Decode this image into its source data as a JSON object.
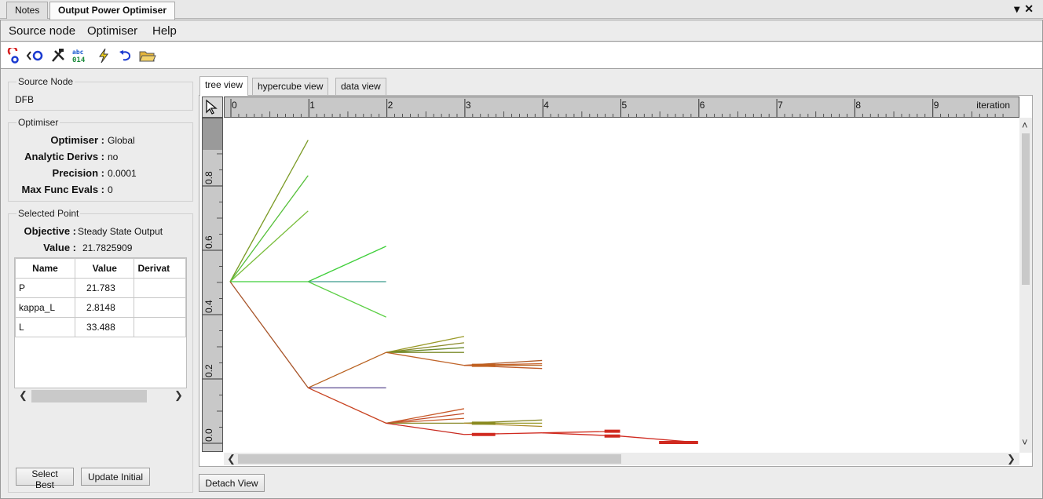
{
  "doc_tabs": [
    {
      "label": "Notes"
    },
    {
      "label": "Output Power Optimiser"
    }
  ],
  "menu": [
    "Source node",
    "Optimiser",
    "Help"
  ],
  "toolbar_icons": [
    "run-icon",
    "step-icon",
    "tools-icon",
    "binary-icon",
    "lightning-icon",
    "undo-icon",
    "open-folder-icon"
  ],
  "source_node": {
    "title": "Source Node",
    "value": "DFB"
  },
  "optimiser": {
    "title": "Optimiser",
    "rows": [
      {
        "label": "Optimiser :",
        "value": "Global"
      },
      {
        "label": "Analytic Derivs :",
        "value": "no"
      },
      {
        "label": "Precision :",
        "value": "0.0001"
      },
      {
        "label": "Max Func Evals :",
        "value": "0"
      }
    ]
  },
  "selected_point": {
    "title": "Selected Point",
    "objective_label": "Objective :",
    "objective_value": "Steady State Output",
    "value_label": "Value :",
    "value_value": "21.7825909",
    "columns": [
      "Name",
      "Value",
      "Derivat"
    ],
    "rows": [
      {
        "name": "P",
        "value": "21.783",
        "deriv": ""
      },
      {
        "name": "kappa_L",
        "value": "2.8148",
        "deriv": ""
      },
      {
        "name": "L",
        "value": "33.488",
        "deriv": ""
      }
    ]
  },
  "buttons": {
    "select_best": "Select Best",
    "update_initial": "Update Initial",
    "detach_view": "Detach View"
  },
  "view_tabs": [
    "tree view",
    "hypercube view",
    "data view"
  ],
  "ruler": {
    "ticks": [
      "0",
      "1",
      "2",
      "3",
      "4",
      "5",
      "6",
      "7",
      "8",
      "9"
    ],
    "label": "iteration"
  },
  "y_ruler": {
    "ticks": [
      "0.0",
      "0.2",
      "0.4",
      "0.6",
      "0.8"
    ]
  },
  "chart_data": {
    "type": "line",
    "title": "",
    "xlabel": "iteration",
    "ylabel": "",
    "xlim": [
      0,
      9.1
    ],
    "ylim": [
      0,
      1.0
    ],
    "series": [
      {
        "color": "#7a9a24",
        "points": [
          [
            0,
            0.5
          ],
          [
            1,
            0.94
          ]
        ]
      },
      {
        "color": "#55c03a",
        "points": [
          [
            0,
            0.5
          ],
          [
            1,
            0.83
          ]
        ]
      },
      {
        "color": "#78bd3a",
        "points": [
          [
            0,
            0.5
          ],
          [
            1,
            0.72
          ]
        ]
      },
      {
        "color": "#3fcf3a",
        "points": [
          [
            0,
            0.5
          ],
          [
            1,
            0.5
          ]
        ]
      },
      {
        "color": "#3fcf3a",
        "points": [
          [
            1,
            0.5
          ],
          [
            2,
            0.61
          ]
        ]
      },
      {
        "color": "#3a9a8c",
        "points": [
          [
            1,
            0.5
          ],
          [
            2,
            0.5
          ]
        ]
      },
      {
        "color": "#5ccf45",
        "points": [
          [
            1,
            0.5
          ],
          [
            2,
            0.39
          ]
        ]
      },
      {
        "color": "#a8552a",
        "points": [
          [
            0,
            0.5
          ],
          [
            1,
            0.17
          ]
        ]
      },
      {
        "color": "#6a5a9a",
        "points": [
          [
            1,
            0.17
          ],
          [
            2,
            0.17
          ]
        ]
      },
      {
        "color": "#b8601e",
        "points": [
          [
            1,
            0.17
          ],
          [
            2,
            0.28
          ]
        ]
      },
      {
        "color": "#c84220",
        "points": [
          [
            1,
            0.17
          ],
          [
            2,
            0.06
          ]
        ]
      },
      {
        "color": "#9a9a28",
        "points": [
          [
            2,
            0.28
          ],
          [
            3,
            0.33
          ]
        ]
      },
      {
        "color": "#8a8a2a",
        "points": [
          [
            2,
            0.28
          ],
          [
            3,
            0.31
          ]
        ]
      },
      {
        "color": "#6a8a2a",
        "points": [
          [
            2,
            0.28
          ],
          [
            3,
            0.295
          ]
        ]
      },
      {
        "color": "#7a8a28",
        "points": [
          [
            2,
            0.28
          ],
          [
            3,
            0.28
          ]
        ]
      },
      {
        "color": "#c0652a",
        "points": [
          [
            2,
            0.28
          ],
          [
            3,
            0.24
          ]
        ]
      },
      {
        "color": "#b05a28",
        "points": [
          [
            3,
            0.24
          ],
          [
            4,
            0.255
          ]
        ]
      },
      {
        "color": "#c8622a",
        "points": [
          [
            3,
            0.24
          ],
          [
            4,
            0.245
          ]
        ]
      },
      {
        "color": "#b86a2a",
        "points": [
          [
            3,
            0.24
          ],
          [
            4,
            0.24
          ]
        ]
      },
      {
        "color": "#c05a28",
        "points": [
          [
            3,
            0.24
          ],
          [
            4,
            0.23
          ]
        ]
      },
      {
        "color": "#c85a2a",
        "points": [
          [
            2,
            0.06
          ],
          [
            3,
            0.105
          ]
        ]
      },
      {
        "color": "#c04a28",
        "points": [
          [
            2,
            0.06
          ],
          [
            3,
            0.09
          ]
        ]
      },
      {
        "color": "#c85a2a",
        "points": [
          [
            2,
            0.06
          ],
          [
            3,
            0.075
          ]
        ]
      },
      {
        "color": "#8a8a2a",
        "points": [
          [
            2,
            0.06
          ],
          [
            3,
            0.06
          ]
        ]
      },
      {
        "color": "#c82a20",
        "points": [
          [
            2,
            0.06
          ],
          [
            3,
            0.025
          ]
        ]
      },
      {
        "color": "#8a8a2a",
        "points": [
          [
            3,
            0.06
          ],
          [
            4,
            0.07
          ]
        ]
      },
      {
        "color": "#9a9a28",
        "points": [
          [
            3,
            0.06
          ],
          [
            4,
            0.06
          ]
        ]
      },
      {
        "color": "#aa8a28",
        "points": [
          [
            3,
            0.06
          ],
          [
            4,
            0.05
          ]
        ]
      },
      {
        "color": "#d02a20",
        "points": [
          [
            3,
            0.025
          ],
          [
            4,
            0.03
          ]
        ]
      },
      {
        "color": "#d03020",
        "points": [
          [
            4,
            0.03
          ],
          [
            5,
            0.035
          ]
        ]
      },
      {
        "color": "#d02a20",
        "points": [
          [
            4,
            0.03
          ],
          [
            5,
            0.02
          ]
        ]
      },
      {
        "color": "#d02a20",
        "points": [
          [
            5,
            0.02
          ],
          [
            6,
            0.0
          ]
        ]
      }
    ]
  }
}
